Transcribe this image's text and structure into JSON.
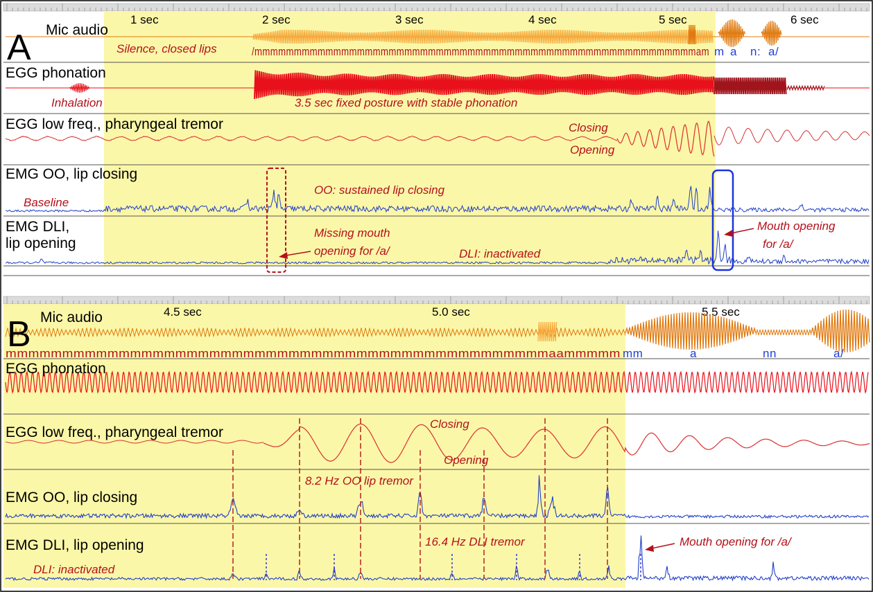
{
  "panelA": {
    "letter": "A",
    "seconds": [
      "1 sec",
      "2 sec",
      "3 sec",
      "4 sec",
      "5 sec",
      "6 sec"
    ],
    "tracks": [
      "Mic audio",
      "EGG phonation",
      "EGG low freq., pharyngeal tremor",
      "EMG OO, lip closing",
      "EMG DLI,",
      "lip opening"
    ],
    "phonetic_red": "/mmmmmmmmmmmmmmmmmmmmmmmmmmmmmmmmmmmmmmmmmmmmmmmmmmmmmmmmam",
    "phonetic_blue": [
      "m",
      "a",
      "n:",
      "a/"
    ],
    "annotations": {
      "silence": "Silence, closed lips",
      "inhalation": "Inhalation",
      "fixed_posture": "3.5 sec fixed posture with stable phonation",
      "closing": "Closing",
      "opening": "Opening",
      "baseline": "Baseline",
      "oo_sustained": "OO: sustained lip closing",
      "missing_1": "Missing mouth",
      "missing_2": "opening for /a/",
      "dli_inactivated": "DLI: inactivated",
      "mouth_open_1": "Mouth opening",
      "mouth_open_2": "for /a/"
    }
  },
  "panelB": {
    "letter": "B",
    "seconds": [
      "4.5 sec",
      "5.0 sec",
      "5.5 sec"
    ],
    "tracks": [
      "Mic audio",
      "EGG phonation",
      "EGG low freq., pharyngeal tremor",
      "EMG OO, lip closing",
      "EMG DLI, lip opening"
    ],
    "phonetic_red": "mmmmmmmmmmmmmmmmmmmmmmmmmmmmmmmmmmmmmmmmmmmmmmmmaammmmm",
    "phonetic_blue": [
      "mm",
      "a",
      "nn",
      "a/"
    ],
    "annotations": {
      "closing": "Closing",
      "opening": "Opening",
      "oo_tremor": "8.2 Hz OO lip tremor",
      "dli_tremor": "16.4 Hz DLI tremor",
      "mouth_open": "Mouth opening for /a/",
      "dli_inactivated": "DLI: inactivated"
    }
  },
  "colors": {
    "highlight": "#fbf7a8",
    "audio": "#e07a10",
    "audio_light": "#f5a83c",
    "egg": "#e8101b",
    "egg_dark": "#a0141c",
    "tremor": "#d93030",
    "emg": "#2040c8",
    "annotation": "#b3111b",
    "box_red": "#b3111b",
    "box_blue": "#1a33e0"
  }
}
